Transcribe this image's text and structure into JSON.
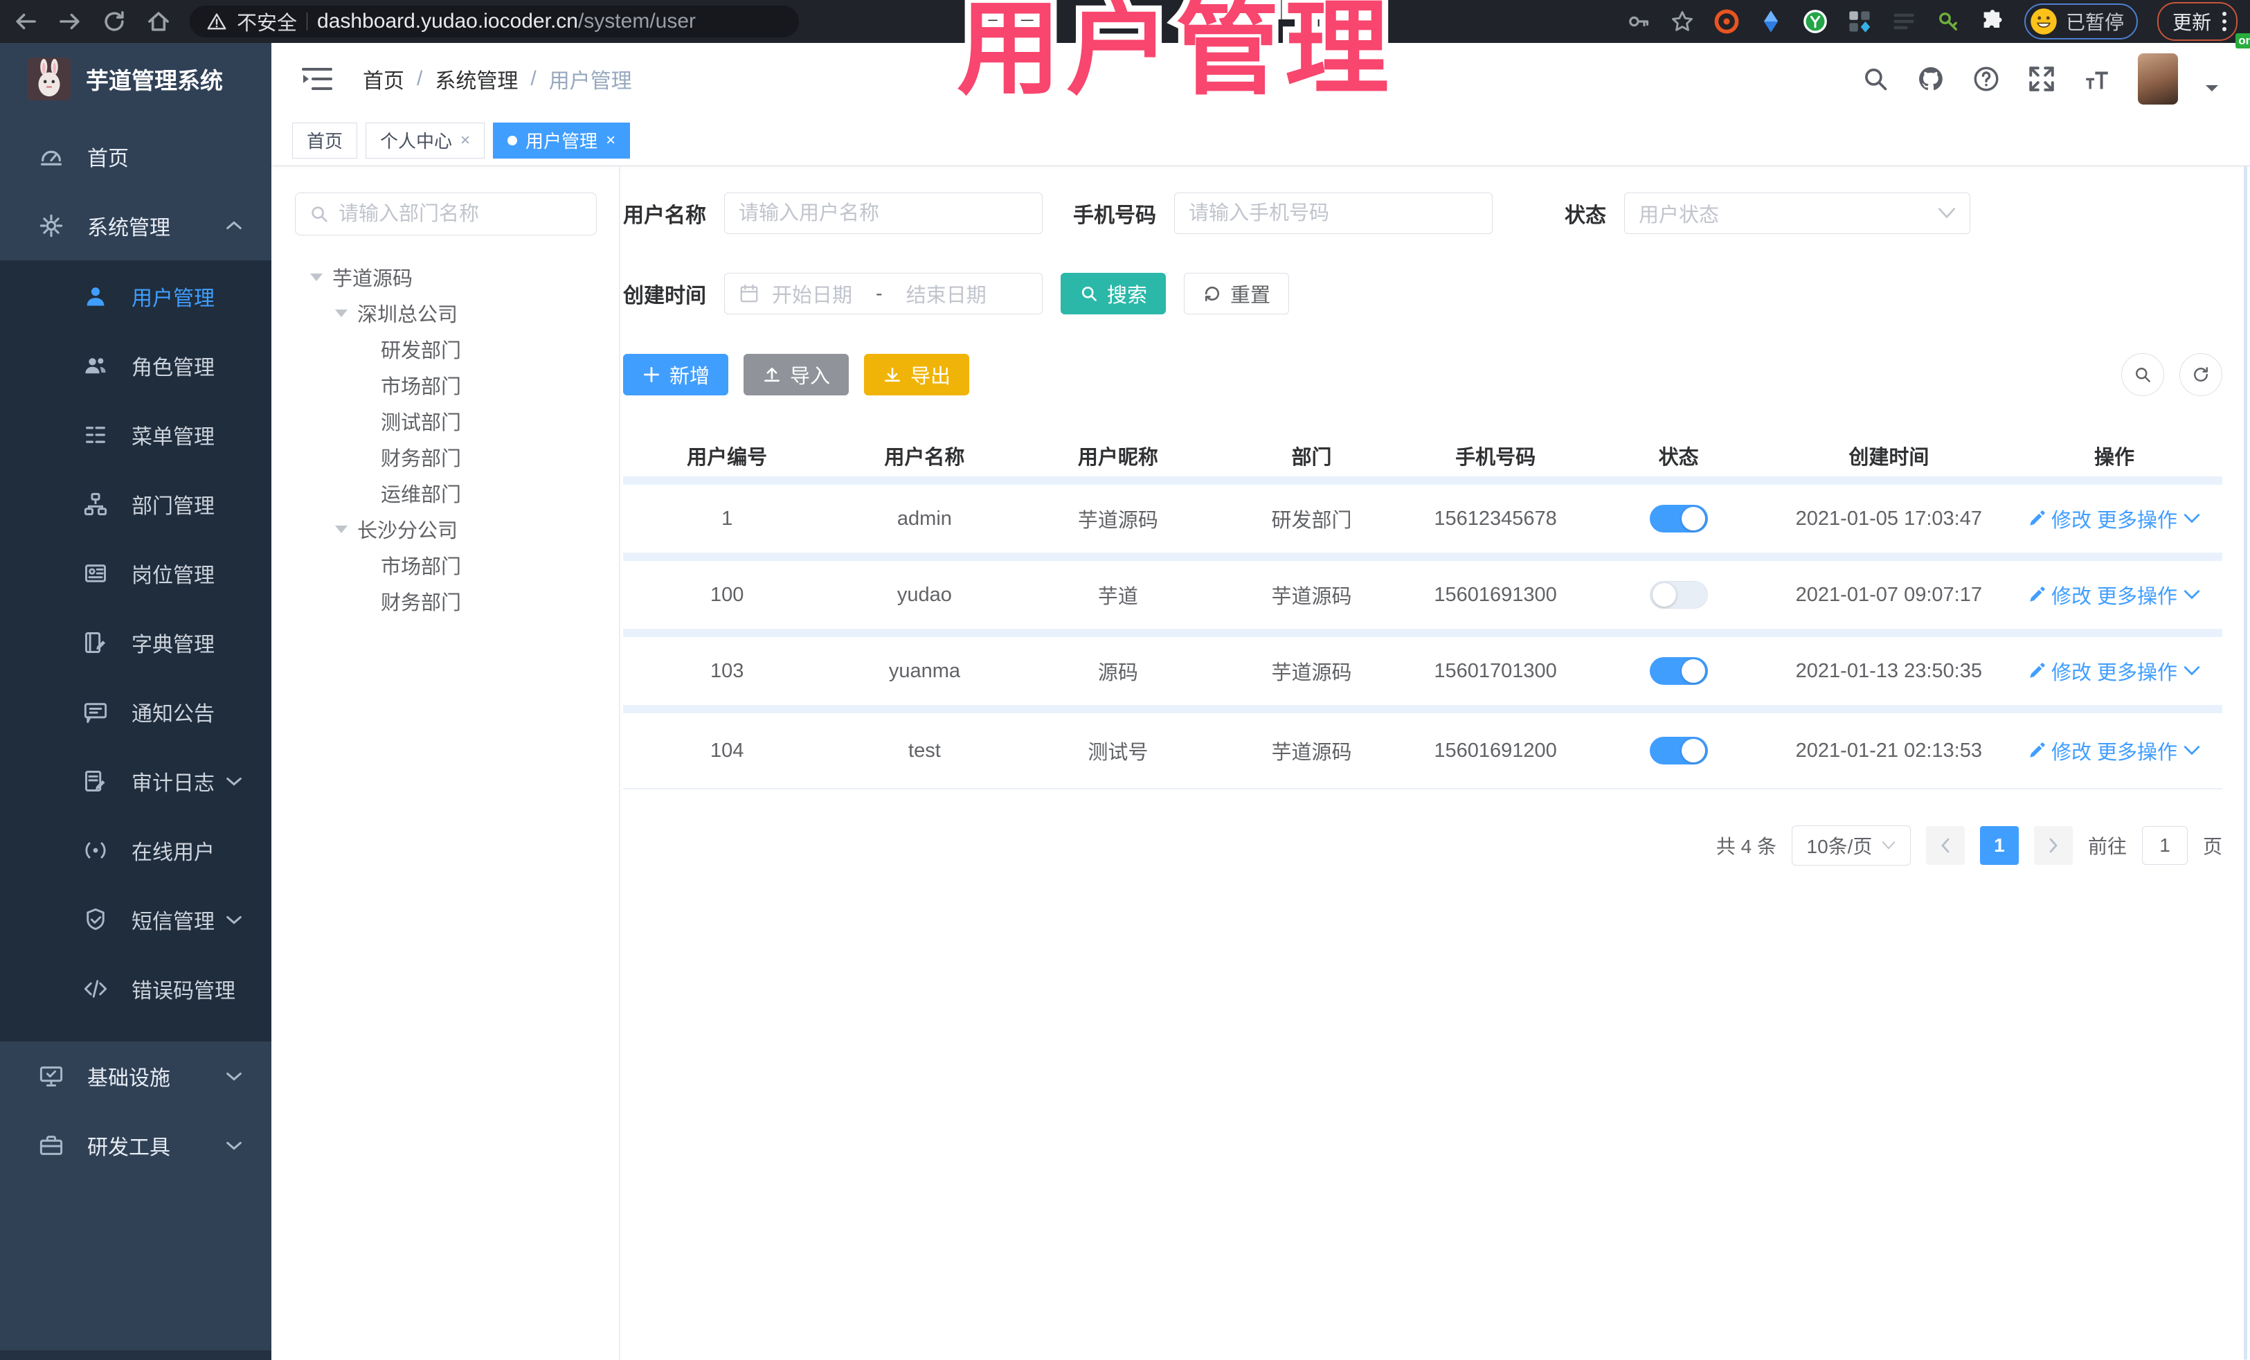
{
  "browser": {
    "security_label": "不安全",
    "url_domain": "dashboard.yudao.iocoder.cn",
    "url_path": "/system/user",
    "profile_status": "已暂停",
    "update_label": "更新"
  },
  "overlay": {
    "title": "用户管理",
    "color": "#f8466e"
  },
  "header": {
    "logo_title": "芋道管理系统",
    "breadcrumb": [
      "首页",
      "系统管理",
      "用户管理"
    ],
    "separator": "/"
  },
  "tabs": [
    {
      "label": "首页"
    },
    {
      "label": "个人中心"
    },
    {
      "label": "用户管理"
    }
  ],
  "sidebar": {
    "items": [
      {
        "label": "首页",
        "icon": "dashboard-icon",
        "level": "top"
      },
      {
        "label": "系统管理",
        "icon": "gear-icon",
        "level": "top",
        "chevron": "up"
      },
      {
        "label": "用户管理",
        "icon": "user-icon",
        "level": "sub",
        "active": true
      },
      {
        "label": "角色管理",
        "icon": "users-icon",
        "level": "sub"
      },
      {
        "label": "菜单管理",
        "icon": "menu-list-icon",
        "level": "sub"
      },
      {
        "label": "部门管理",
        "icon": "org-tree-icon",
        "level": "sub"
      },
      {
        "label": "岗位管理",
        "icon": "badge-icon",
        "level": "sub"
      },
      {
        "label": "字典管理",
        "icon": "dictionary-icon",
        "level": "sub"
      },
      {
        "label": "通知公告",
        "icon": "announcement-icon",
        "level": "sub"
      },
      {
        "label": "审计日志",
        "icon": "audit-log-icon",
        "level": "sub",
        "chevron": "down"
      },
      {
        "label": "在线用户",
        "icon": "online-users-icon",
        "level": "sub"
      },
      {
        "label": "短信管理",
        "icon": "sms-icon",
        "level": "sub",
        "chevron": "down"
      },
      {
        "label": "错误码管理",
        "icon": "error-code-icon",
        "level": "sub"
      },
      {
        "label": "基础设施",
        "icon": "infrastructure-icon",
        "level": "top",
        "chevron": "down"
      },
      {
        "label": "研发工具",
        "icon": "dev-tools-icon",
        "level": "top",
        "chevron": "down"
      }
    ]
  },
  "tree": {
    "search_placeholder": "请输入部门名称",
    "nodes": [
      {
        "label": "芋道源码",
        "level": 1,
        "expandable": true
      },
      {
        "label": "深圳总公司",
        "level": 2,
        "expandable": true
      },
      {
        "label": "研发部门",
        "level": 3
      },
      {
        "label": "市场部门",
        "level": 3
      },
      {
        "label": "测试部门",
        "level": 3
      },
      {
        "label": "财务部门",
        "level": 3
      },
      {
        "label": "运维部门",
        "level": 3
      },
      {
        "label": "长沙分公司",
        "level": 2,
        "expandable": true
      },
      {
        "label": "市场部门",
        "level": 3
      },
      {
        "label": "财务部门",
        "level": 3
      }
    ]
  },
  "filters": {
    "username_label": "用户名称",
    "username_placeholder": "请输入用户名称",
    "mobile_label": "手机号码",
    "mobile_placeholder": "请输入手机号码",
    "status_label": "状态",
    "status_placeholder": "用户状态",
    "create_time_label": "创建时间",
    "date_start_placeholder": "开始日期",
    "date_separator": "-",
    "date_end_placeholder": "结束日期",
    "search_label": "搜索",
    "reset_label": "重置"
  },
  "toolbar": {
    "add_label": "新增",
    "import_label": "导入",
    "export_label": "导出"
  },
  "table": {
    "columns": [
      "用户编号",
      "用户名称",
      "用户昵称",
      "部门",
      "手机号码",
      "状态",
      "创建时间",
      "操作"
    ],
    "rows": [
      {
        "id": "1",
        "username": "admin",
        "nickname": "芋道源码",
        "dept": "研发部门",
        "mobile": "15612345678",
        "status_on": true,
        "created": "2021-01-05 17:03:47"
      },
      {
        "id": "100",
        "username": "yudao",
        "nickname": "芋道",
        "dept": "芋道源码",
        "mobile": "15601691300",
        "status_on": false,
        "created": "2021-01-07 09:07:17"
      },
      {
        "id": "103",
        "username": "yuanma",
        "nickname": "源码",
        "dept": "芋道源码",
        "mobile": "15601701300",
        "status_on": true,
        "created": "2021-01-13 23:50:35"
      },
      {
        "id": "104",
        "username": "test",
        "nickname": "测试号",
        "dept": "芋道源码",
        "mobile": "15601691200",
        "status_on": true,
        "created": "2021-01-21 02:13:53"
      }
    ],
    "actions": {
      "edit": "修改",
      "more": "更多操作"
    }
  },
  "pagination": {
    "total_text": "共 4 条",
    "page_size": "10条/页",
    "current_page": "1",
    "goto_label": "前往",
    "goto_value": "1",
    "page_unit": "页"
  },
  "colors": {
    "accent": "#409EFF",
    "search_teal": "#2bb8a9",
    "export_yellow": "#f0b408",
    "sidebar": "#304156",
    "sidebar_dark": "#1f2d3d",
    "overlay_pink": "#f8466e"
  }
}
